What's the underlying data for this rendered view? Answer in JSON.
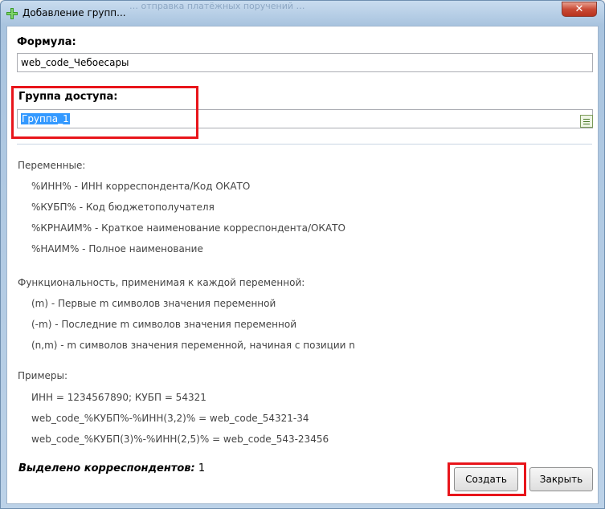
{
  "window": {
    "title": "Добавление групп...",
    "background_title_fragment": "… отправка платёжных поручений …"
  },
  "formula": {
    "label": "Формула:",
    "value": "web_code_Чебоесары"
  },
  "access_group": {
    "label": "Группа доступа:",
    "value": "Группа_1"
  },
  "help": {
    "variables_header": "Переменные:",
    "variables": [
      "%ИНН% - ИНН корреспондента/Код ОКАТО",
      "%КУБП% - Код бюджетополучателя",
      "%КРНАИМ% - Краткое наименование корреспондента/ОКАТО",
      "%НАИМ% - Полное наименование"
    ],
    "functions_header": "Функциональность, применимая к каждой переменной:",
    "functions": [
      "(m) - Первые m символов значения переменной",
      "(-m) - Последние m символов значения переменной",
      "(n,m) - m символов значения переменной, начиная с позиции n"
    ],
    "examples_header": "Примеры:",
    "examples": [
      "ИНН = 1234567890;  КУБП = 54321",
      "web_code_%КУБП%-%ИНН(3,2)%  =  web_code_54321-34",
      "web_code_%КУБП(3)%-%ИНН(2,5)%  =  web_code_543-23456"
    ]
  },
  "footer": {
    "selected_label": "Выделено корреспондентов:",
    "selected_count": "1",
    "create_button": "Создать",
    "close_button": "Закрыть"
  },
  "colors": {
    "highlight": "#e8151b",
    "selection": "#3399ff"
  },
  "icons": {
    "app": "green-plus-icon",
    "close": "close-icon",
    "picker": "list-picker-icon"
  }
}
